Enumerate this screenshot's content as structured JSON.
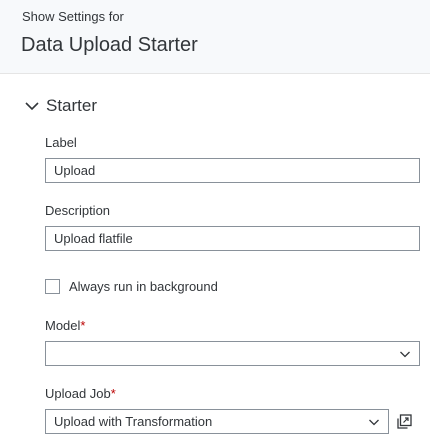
{
  "header": {
    "subtitle": "Show Settings for",
    "title": "Data Upload Starter"
  },
  "section": {
    "title": "Starter",
    "expanded": true
  },
  "fields": {
    "label": {
      "label": "Label",
      "value": "Upload"
    },
    "description": {
      "label": "Description",
      "value": "Upload flatfile"
    },
    "always_background": {
      "label": "Always run in background",
      "checked": false
    },
    "model": {
      "label": "Model",
      "required_mark": "*",
      "value": ""
    },
    "upload_job": {
      "label": "Upload Job",
      "required_mark": "*",
      "value": "Upload with Transformation"
    }
  },
  "icons": {
    "section_chevron": "chevron-down-icon",
    "dropdown_arrow": "chevron-down-icon",
    "value_help": "open-dialog-icon"
  },
  "colors": {
    "header_bg": "#f7f9fb",
    "text": "#32363a",
    "border": "#89919a",
    "required": "#bb0000",
    "accent": "#0a6ed1"
  }
}
